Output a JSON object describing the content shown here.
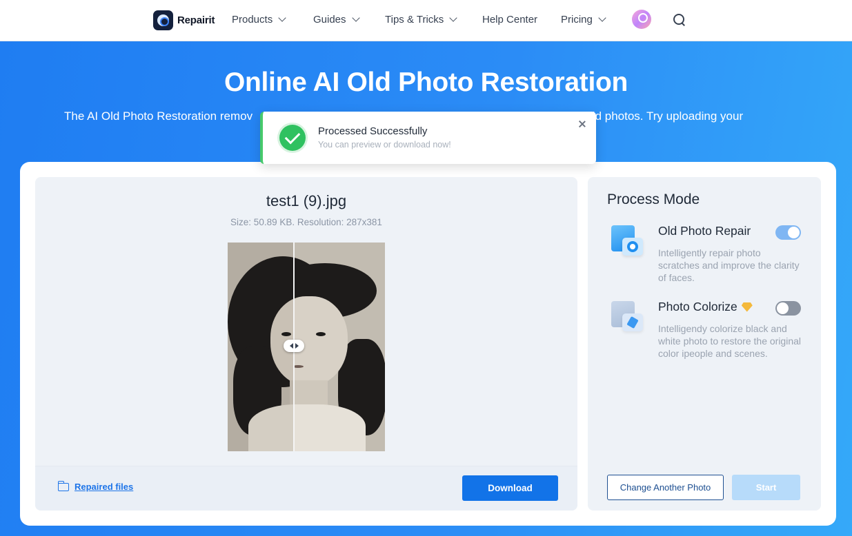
{
  "nav": {
    "logo_text": "Repairit",
    "items": [
      {
        "label": "Products",
        "has_dropdown": true
      },
      {
        "label": "Guides",
        "has_dropdown": true
      },
      {
        "label": "Tips & Tricks",
        "has_dropdown": true
      },
      {
        "label": "Help Center",
        "has_dropdown": false
      },
      {
        "label": "Pricing",
        "has_dropdown": true
      }
    ],
    "icons": {
      "avatar": "user-avatar-icon",
      "search": "search-icon"
    }
  },
  "hero": {
    "title": "Online AI Old Photo Restoration",
    "subtitle_left": "The AI Old Photo Restoration remov",
    "subtitle_right": "your old photos. Try uploading your"
  },
  "toast": {
    "title": "Processed Successfully",
    "message": "You can preview or download now!",
    "icon": "check-circle-icon",
    "accent_color": "#2fc160"
  },
  "preview": {
    "file_name": "test1 (9).jpg",
    "meta": "Size: 50.89 KB. Resolution: 287x381",
    "repaired_files_label": "Repaired files",
    "download_label": "Download",
    "compare_split_percent": 42
  },
  "process_mode": {
    "title": "Process Mode",
    "modes": [
      {
        "name": "Old Photo Repair",
        "description": "Intelligently repair photo scratches and improve the clarity of faces.",
        "enabled": true,
        "premium": false,
        "icon": "photo-repair-icon"
      },
      {
        "name": "Photo Colorize",
        "description": "Intelligendy colorize black and white photo to restore the original color ipeople and scenes.",
        "enabled": false,
        "premium": true,
        "icon": "photo-colorize-icon"
      }
    ],
    "change_label": "Change Another Photo",
    "start_label": "Start"
  },
  "colors": {
    "primary": "#1273e8",
    "hero_gradient_start": "#1f7df2",
    "hero_gradient_end": "#35a9f9",
    "success": "#2fc160",
    "premium": "#f4b93c"
  }
}
